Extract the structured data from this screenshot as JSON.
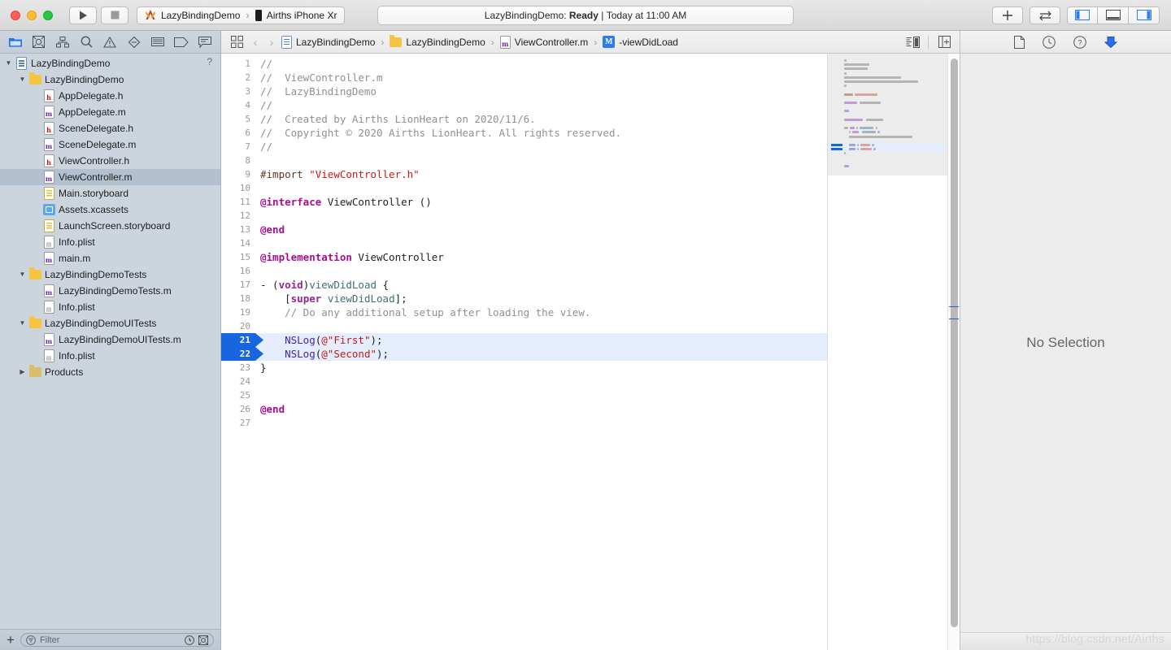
{
  "titlebar": {
    "run_icon": "play-icon",
    "stop_icon": "stop-icon",
    "scheme_name": "LazyBindingDemo",
    "scheme_separator": "›",
    "destination_name": "Airths iPhone Xr",
    "status_prefix": "LazyBindingDemo:",
    "status_state": "Ready",
    "status_divider": "|",
    "status_time": "Today at 11:00 AM",
    "add_label": "+",
    "swap_icon": "swap-arrows-icon",
    "left_panel_icon": "left-panel-toggle-icon",
    "bottom_panel_icon": "bottom-panel-toggle-icon",
    "right_panel_icon": "right-panel-toggle-icon"
  },
  "navigator": {
    "tabs": [
      {
        "name": "project-navigator",
        "icon": "folder-icon",
        "active": true
      },
      {
        "name": "source-control-navigator",
        "icon": "source-control-icon",
        "active": false
      },
      {
        "name": "symbol-navigator",
        "icon": "symbol-hierarchy-icon",
        "active": false
      },
      {
        "name": "find-navigator",
        "icon": "search-icon",
        "active": false
      },
      {
        "name": "issue-navigator",
        "icon": "warning-triangle-icon",
        "active": false
      },
      {
        "name": "test-navigator",
        "icon": "diamond-icon",
        "active": false
      },
      {
        "name": "debug-navigator",
        "icon": "list-lines-icon",
        "active": false
      },
      {
        "name": "breakpoint-navigator",
        "icon": "breakpoint-tag-icon",
        "active": false
      },
      {
        "name": "report-navigator",
        "icon": "speech-bubble-icon",
        "active": false
      }
    ],
    "help_glyph": "?",
    "tree": [
      {
        "label": "LazyBindingDemo",
        "indent": 0,
        "twisty": "down",
        "icon": "project",
        "selected": false
      },
      {
        "label": "LazyBindingDemo",
        "indent": 1,
        "twisty": "down",
        "icon": "folder",
        "selected": false
      },
      {
        "label": "AppDelegate.h",
        "indent": 2,
        "twisty": "",
        "icon": "h",
        "selected": false
      },
      {
        "label": "AppDelegate.m",
        "indent": 2,
        "twisty": "",
        "icon": "m",
        "selected": false
      },
      {
        "label": "SceneDelegate.h",
        "indent": 2,
        "twisty": "",
        "icon": "h",
        "selected": false
      },
      {
        "label": "SceneDelegate.m",
        "indent": 2,
        "twisty": "",
        "icon": "m",
        "selected": false
      },
      {
        "label": "ViewController.h",
        "indent": 2,
        "twisty": "",
        "icon": "h",
        "selected": false
      },
      {
        "label": "ViewController.m",
        "indent": 2,
        "twisty": "",
        "icon": "m",
        "selected": true
      },
      {
        "label": "Main.storyboard",
        "indent": 2,
        "twisty": "",
        "icon": "storyboard",
        "selected": false
      },
      {
        "label": "Assets.xcassets",
        "indent": 2,
        "twisty": "",
        "icon": "xcassets",
        "selected": false
      },
      {
        "label": "LaunchScreen.storyboard",
        "indent": 2,
        "twisty": "",
        "icon": "storyboard",
        "selected": false
      },
      {
        "label": "Info.plist",
        "indent": 2,
        "twisty": "",
        "icon": "plist",
        "selected": false
      },
      {
        "label": "main.m",
        "indent": 2,
        "twisty": "",
        "icon": "m",
        "selected": false
      },
      {
        "label": "LazyBindingDemoTests",
        "indent": 1,
        "twisty": "down",
        "icon": "folder",
        "selected": false
      },
      {
        "label": "LazyBindingDemoTests.m",
        "indent": 2,
        "twisty": "",
        "icon": "m",
        "selected": false
      },
      {
        "label": "Info.plist",
        "indent": 2,
        "twisty": "",
        "icon": "plist",
        "selected": false
      },
      {
        "label": "LazyBindingDemoUITests",
        "indent": 1,
        "twisty": "down",
        "icon": "folder",
        "selected": false
      },
      {
        "label": "LazyBindingDemoUITests.m",
        "indent": 2,
        "twisty": "",
        "icon": "m",
        "selected": false
      },
      {
        "label": "Info.plist",
        "indent": 2,
        "twisty": "",
        "icon": "plist",
        "selected": false
      },
      {
        "label": "Products",
        "indent": 1,
        "twisty": "right",
        "icon": "folder-grey",
        "selected": false
      }
    ],
    "add_button": "+",
    "filter_placeholder": "Filter",
    "filter_value": "",
    "filter_icon": "filter-funnel-icon",
    "recent_icon": "clock-icon",
    "scm_icon": "source-control-filter-icon"
  },
  "jumpbar": {
    "related_icon": "related-items-icon",
    "back_glyph": "‹",
    "forward_glyph": "›",
    "crumbs": [
      {
        "label": "LazyBindingDemo",
        "icon": "project"
      },
      {
        "label": "LazyBindingDemo",
        "icon": "folder"
      },
      {
        "label": "ViewController.m",
        "icon": "m"
      },
      {
        "label": "-viewDidLoad",
        "icon": "method-m-icon"
      }
    ],
    "separator": "›",
    "minimap_icon": "minimap-toggle-icon",
    "add_editor_icon": "add-editor-icon"
  },
  "editor": {
    "lines": [
      {
        "n": 1,
        "bp": false,
        "hl": false,
        "tokens": [
          {
            "t": "//",
            "c": "c-cmt"
          }
        ]
      },
      {
        "n": 2,
        "bp": false,
        "hl": false,
        "tokens": [
          {
            "t": "//  ViewController.m",
            "c": "c-cmt"
          }
        ]
      },
      {
        "n": 3,
        "bp": false,
        "hl": false,
        "tokens": [
          {
            "t": "//  LazyBindingDemo",
            "c": "c-cmt"
          }
        ]
      },
      {
        "n": 4,
        "bp": false,
        "hl": false,
        "tokens": [
          {
            "t": "//",
            "c": "c-cmt"
          }
        ]
      },
      {
        "n": 5,
        "bp": false,
        "hl": false,
        "tokens": [
          {
            "t": "//  Created by Airths LionHeart on 2020/11/6.",
            "c": "c-cmt"
          }
        ]
      },
      {
        "n": 6,
        "bp": false,
        "hl": false,
        "tokens": [
          {
            "t": "//  Copyright © 2020 Airths LionHeart. All rights reserved.",
            "c": "c-cmt"
          }
        ]
      },
      {
        "n": 7,
        "bp": false,
        "hl": false,
        "tokens": [
          {
            "t": "//",
            "c": "c-cmt"
          }
        ]
      },
      {
        "n": 8,
        "bp": false,
        "hl": false,
        "tokens": []
      },
      {
        "n": 9,
        "bp": false,
        "hl": false,
        "tokens": [
          {
            "t": "#import ",
            "c": "c-pre"
          },
          {
            "t": "\"ViewController.h\"",
            "c": "c-str"
          }
        ]
      },
      {
        "n": 10,
        "bp": false,
        "hl": false,
        "tokens": []
      },
      {
        "n": 11,
        "bp": false,
        "hl": false,
        "tokens": [
          {
            "t": "@interface",
            "c": "c-kw2"
          },
          {
            "t": " ViewController ()",
            "c": "c-pln"
          }
        ]
      },
      {
        "n": 12,
        "bp": false,
        "hl": false,
        "tokens": []
      },
      {
        "n": 13,
        "bp": false,
        "hl": false,
        "tokens": [
          {
            "t": "@end",
            "c": "c-kw2"
          }
        ]
      },
      {
        "n": 14,
        "bp": false,
        "hl": false,
        "tokens": []
      },
      {
        "n": 15,
        "bp": false,
        "hl": false,
        "tokens": [
          {
            "t": "@implementation",
            "c": "c-kw2"
          },
          {
            "t": " ViewController",
            "c": "c-pln"
          }
        ]
      },
      {
        "n": 16,
        "bp": false,
        "hl": false,
        "tokens": []
      },
      {
        "n": 17,
        "bp": false,
        "hl": false,
        "tokens": [
          {
            "t": "- (",
            "c": "c-pln"
          },
          {
            "t": "void",
            "c": "c-kw"
          },
          {
            "t": ")",
            "c": "c-pln"
          },
          {
            "t": "viewDidLoad",
            "c": "c-type"
          },
          {
            "t": " {",
            "c": "c-pln"
          }
        ]
      },
      {
        "n": 18,
        "bp": false,
        "hl": false,
        "tokens": [
          {
            "t": "    [",
            "c": "c-pln"
          },
          {
            "t": "super",
            "c": "c-kw"
          },
          {
            "t": " ",
            "c": "c-pln"
          },
          {
            "t": "viewDidLoad",
            "c": "c-type"
          },
          {
            "t": "];",
            "c": "c-pln"
          }
        ]
      },
      {
        "n": 19,
        "bp": false,
        "hl": false,
        "tokens": [
          {
            "t": "    // Do any additional setup after loading the view.",
            "c": "c-cmt"
          }
        ]
      },
      {
        "n": 20,
        "bp": false,
        "hl": false,
        "tokens": []
      },
      {
        "n": 21,
        "bp": true,
        "hl": true,
        "tokens": [
          {
            "t": "    ",
            "c": "c-pln"
          },
          {
            "t": "NSLog",
            "c": "c-fn"
          },
          {
            "t": "(",
            "c": "c-pln"
          },
          {
            "t": "@\"First\"",
            "c": "c-str"
          },
          {
            "t": ");",
            "c": "c-pln"
          }
        ]
      },
      {
        "n": 22,
        "bp": true,
        "hl": true,
        "tokens": [
          {
            "t": "    ",
            "c": "c-pln"
          },
          {
            "t": "NSLog",
            "c": "c-fn"
          },
          {
            "t": "(",
            "c": "c-pln"
          },
          {
            "t": "@\"Second\"",
            "c": "c-str"
          },
          {
            "t": ");",
            "c": "c-pln"
          }
        ]
      },
      {
        "n": 23,
        "bp": false,
        "hl": false,
        "tokens": [
          {
            "t": "}",
            "c": "c-pln"
          }
        ]
      },
      {
        "n": 24,
        "bp": false,
        "hl": false,
        "tokens": []
      },
      {
        "n": 25,
        "bp": false,
        "hl": false,
        "tokens": []
      },
      {
        "n": 26,
        "bp": false,
        "hl": false,
        "tokens": [
          {
            "t": "@end",
            "c": "c-kw2"
          }
        ]
      },
      {
        "n": 27,
        "bp": false,
        "hl": false,
        "tokens": []
      }
    ]
  },
  "inspector": {
    "tabs": [
      {
        "name": "file-inspector",
        "icon": "document-icon"
      },
      {
        "name": "history-inspector",
        "icon": "clock-icon"
      },
      {
        "name": "quick-help-inspector",
        "icon": "question-circle-icon"
      },
      {
        "name": "library-inspector",
        "icon": "blue-arrow-down-icon"
      }
    ],
    "empty_message": "No Selection"
  },
  "watermark": "https://blog.csdn.net/Airths",
  "colors": {
    "accent_blue": "#1766e0",
    "navigator_bg": "#ccd5de",
    "selection_row": "#b3c0d0",
    "line_highlight": "#e3edfb",
    "string_red": "#c41a16",
    "keyword_magenta": "#9b2393",
    "comment_grey": "#8e9094"
  }
}
